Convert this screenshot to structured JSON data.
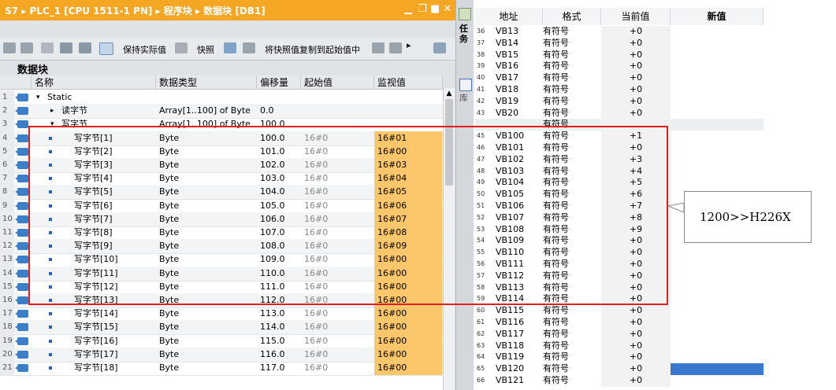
{
  "window": {
    "title": "S7 ▸ PLC_1 [CPU 1511-1 PN] ▸ 程序块 ▸ 数据块 [DB1]",
    "title_bar_color": "#f5a623"
  },
  "toolbar": {
    "keep_actual_label": "保持实际值",
    "snapshot_label": "快照",
    "copy_snapshot_label": "将快照值复制到起始值中"
  },
  "block_label": "数据块",
  "side_tabs": {
    "tasks": "任务",
    "library": "库"
  },
  "columns": {
    "name": "名称",
    "datatype": "数据类型",
    "offset": "偏移量",
    "start": "起始值",
    "monitor": "监视值"
  },
  "rows": [
    {
      "num": "1",
      "name": "Static",
      "type": "",
      "offset": "",
      "start": "",
      "monitor": ""
    },
    {
      "num": "2",
      "name": "读字节",
      "type": "Array[1..100] of Byte",
      "offset": "0.0",
      "start": "",
      "monitor": ""
    },
    {
      "num": "3",
      "name": "写字节",
      "type": "Array[1..100] of Byte",
      "offset": "100.0",
      "start": "",
      "monitor": ""
    },
    {
      "num": "4",
      "name": "写字节[1]",
      "type": "Byte",
      "offset": "100.0",
      "start": "16#0",
      "monitor": "16#01"
    },
    {
      "num": "5",
      "name": "写字节[2]",
      "type": "Byte",
      "offset": "101.0",
      "start": "16#0",
      "monitor": "16#00"
    },
    {
      "num": "6",
      "name": "写字节[3]",
      "type": "Byte",
      "offset": "102.0",
      "start": "16#0",
      "monitor": "16#03"
    },
    {
      "num": "7",
      "name": "写字节[4]",
      "type": "Byte",
      "offset": "103.0",
      "start": "16#0",
      "monitor": "16#04"
    },
    {
      "num": "8",
      "name": "写字节[5]",
      "type": "Byte",
      "offset": "104.0",
      "start": "16#0",
      "monitor": "16#05"
    },
    {
      "num": "9",
      "name": "写字节[6]",
      "type": "Byte",
      "offset": "105.0",
      "start": "16#0",
      "monitor": "16#06"
    },
    {
      "num": "10",
      "name": "写字节[7]",
      "type": "Byte",
      "offset": "106.0",
      "start": "16#0",
      "monitor": "16#07"
    },
    {
      "num": "11",
      "name": "写字节[8]",
      "type": "Byte",
      "offset": "107.0",
      "start": "16#0",
      "monitor": "16#08"
    },
    {
      "num": "12",
      "name": "写字节[9]",
      "type": "Byte",
      "offset": "108.0",
      "start": "16#0",
      "monitor": "16#09"
    },
    {
      "num": "13",
      "name": "写字节[10]",
      "type": "Byte",
      "offset": "109.0",
      "start": "16#0",
      "monitor": "16#00"
    },
    {
      "num": "14",
      "name": "写字节[11]",
      "type": "Byte",
      "offset": "110.0",
      "start": "16#0",
      "monitor": "16#00"
    },
    {
      "num": "15",
      "name": "写字节[12]",
      "type": "Byte",
      "offset": "111.0",
      "start": "16#0",
      "monitor": "16#00"
    },
    {
      "num": "16",
      "name": "写字节[13]",
      "type": "Byte",
      "offset": "112.0",
      "start": "16#0",
      "monitor": "16#00"
    },
    {
      "num": "17",
      "name": "写字节[14]",
      "type": "Byte",
      "offset": "113.0",
      "start": "16#0",
      "monitor": "16#00"
    },
    {
      "num": "18",
      "name": "写字节[15]",
      "type": "Byte",
      "offset": "114.0",
      "start": "16#0",
      "monitor": "16#00"
    },
    {
      "num": "19",
      "name": "写字节[16]",
      "type": "Byte",
      "offset": "115.0",
      "start": "16#0",
      "monitor": "16#00"
    },
    {
      "num": "20",
      "name": "写字节[17]",
      "type": "Byte",
      "offset": "116.0",
      "start": "16#0",
      "monitor": "16#00"
    },
    {
      "num": "21",
      "name": "写字节[18]",
      "type": "Byte",
      "offset": "117.0",
      "start": "16#0",
      "monitor": "16#00"
    }
  ],
  "watch": {
    "headers": {
      "address": "地址",
      "format": "格式",
      "current": "当前值",
      "new": "新值"
    },
    "rows": [
      {
        "n": "36",
        "addr": "VB13",
        "fmt": "有符号",
        "val": "+0"
      },
      {
        "n": "37",
        "addr": "VB14",
        "fmt": "有符号",
        "val": "+0"
      },
      {
        "n": "38",
        "addr": "VB15",
        "fmt": "有符号",
        "val": "+0"
      },
      {
        "n": "39",
        "addr": "VB16",
        "fmt": "有符号",
        "val": "+0"
      },
      {
        "n": "40",
        "addr": "VB17",
        "fmt": "有符号",
        "val": "+0"
      },
      {
        "n": "41",
        "addr": "VB18",
        "fmt": "有符号",
        "val": "+0"
      },
      {
        "n": "42",
        "addr": "VB19",
        "fmt": "有符号",
        "val": "+0"
      },
      {
        "n": "43",
        "addr": "VB20",
        "fmt": "有符号",
        "val": "+0"
      },
      {
        "n": "",
        "addr": "",
        "fmt": "有符号",
        "val": ""
      },
      {
        "n": "45",
        "addr": "VB100",
        "fmt": "有符号",
        "val": "+1"
      },
      {
        "n": "46",
        "addr": "VB101",
        "fmt": "有符号",
        "val": "+0"
      },
      {
        "n": "47",
        "addr": "VB102",
        "fmt": "有符号",
        "val": "+3"
      },
      {
        "n": "48",
        "addr": "VB103",
        "fmt": "有符号",
        "val": "+4"
      },
      {
        "n": "49",
        "addr": "VB104",
        "fmt": "有符号",
        "val": "+5"
      },
      {
        "n": "50",
        "addr": "VB105",
        "fmt": "有符号",
        "val": "+6"
      },
      {
        "n": "51",
        "addr": "VB106",
        "fmt": "有符号",
        "val": "+7"
      },
      {
        "n": "52",
        "addr": "VB107",
        "fmt": "有符号",
        "val": "+8"
      },
      {
        "n": "53",
        "addr": "VB108",
        "fmt": "有符号",
        "val": "+9"
      },
      {
        "n": "54",
        "addr": "VB109",
        "fmt": "有符号",
        "val": "+0"
      },
      {
        "n": "55",
        "addr": "VB110",
        "fmt": "有符号",
        "val": "+0"
      },
      {
        "n": "56",
        "addr": "VB111",
        "fmt": "有符号",
        "val": "+0"
      },
      {
        "n": "57",
        "addr": "VB112",
        "fmt": "有符号",
        "val": "+0"
      },
      {
        "n": "58",
        "addr": "VB113",
        "fmt": "有符号",
        "val": "+0"
      },
      {
        "n": "59",
        "addr": "VB114",
        "fmt": "有符号",
        "val": "+0"
      },
      {
        "n": "60",
        "addr": "VB115",
        "fmt": "有符号",
        "val": "+0"
      },
      {
        "n": "61",
        "addr": "VB116",
        "fmt": "有符号",
        "val": "+0"
      },
      {
        "n": "62",
        "addr": "VB117",
        "fmt": "有符号",
        "val": "+0"
      },
      {
        "n": "63",
        "addr": "VB118",
        "fmt": "有符号",
        "val": "+0"
      },
      {
        "n": "64",
        "addr": "VB119",
        "fmt": "有符号",
        "val": "+0"
      },
      {
        "n": "65",
        "addr": "VB120",
        "fmt": "有符号",
        "val": "+0"
      },
      {
        "n": "66",
        "addr": "VB121",
        "fmt": "有符号",
        "val": "+0"
      }
    ]
  },
  "annotation": {
    "callout_text": "1200>>H226X",
    "box_color": "#e0201c"
  },
  "colors": {
    "monitor_fill": "#fcc66a",
    "selection_blue": "#3a78d0"
  }
}
